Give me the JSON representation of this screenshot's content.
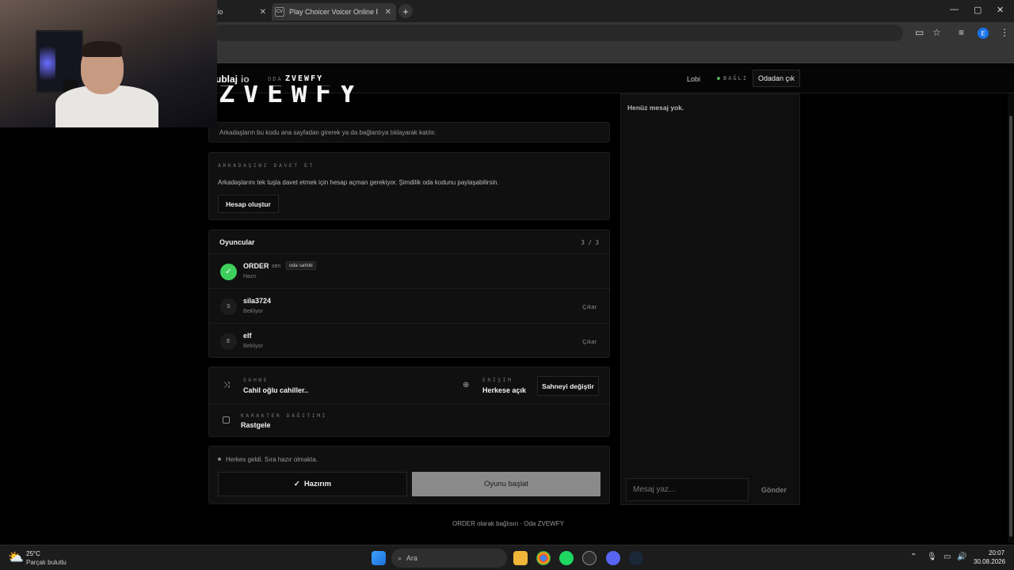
{
  "browser": {
    "tabs": [
      {
        "title": ".io",
        "active": false
      },
      {
        "title": "Play Choicer Voicer Online Free",
        "favicon": "CV",
        "active": true
      }
    ],
    "window_controls": [
      "—",
      "▢",
      "✕"
    ]
  },
  "webcam": {
    "description_icon": "webcam-overlay"
  },
  "header": {
    "logo_main": "ublaj",
    "logo_suffix": "io",
    "room_label": "ODA",
    "room_code": "ZVEWFY",
    "nav_lobby": "Lobi",
    "status": "BAĞLI",
    "leave_label": "Odadan çık"
  },
  "room": {
    "big_code": "ZVEWFY",
    "join_hint": "Arkadaşların bu kodu ana sayfadan girerek ya da bağlantıya tıklayarak katılır."
  },
  "invite": {
    "heading": "ARKADAŞINI DAVET ET",
    "text": "Arkadaşlarını tek tuşla davet etmek için hesap açman gerekiyor. Şimdilik oda kodunu paylaşabilirsin.",
    "button": "Hesap oluştur"
  },
  "players": {
    "title": "Oyuncular",
    "count": "3 / 3",
    "list": [
      {
        "initial": "✓",
        "name": "ORDER",
        "you": "sen",
        "badge": "oda sahibi",
        "status": "Hazır",
        "kick": ""
      },
      {
        "initial": "S",
        "name": "sila3724",
        "status": "Bekliyor",
        "kick": "Çıkar"
      },
      {
        "initial": "E",
        "name": "elf",
        "status": "Bekliyor",
        "kick": "Çıkar"
      }
    ]
  },
  "settings": {
    "scene_label": "SAHNE",
    "scene_value": "Cahil oğlu cahiller..",
    "access_label": "ERİŞİM",
    "access_value": "Herkese açık",
    "change_scene": "Sahneyi değiştir",
    "cast_label": "KARAKTER DAĞITIMI",
    "cast_value": "Rastgele"
  },
  "ready": {
    "message": "Herkes geldi. Sıra hazır olmakta.",
    "ready_button": "Hazırım",
    "start_button": "Oyunu başlat"
  },
  "footer": {
    "text": "ORDER olarak bağlısın · Oda ZVEWFY"
  },
  "chat": {
    "empty": "Henüz mesaj yok.",
    "placeholder": "Mesaj yaz...",
    "send": "Gönder"
  },
  "taskbar": {
    "weather_temp": "25°C",
    "weather_desc": "Parçalı bulutlu",
    "search": "Ara",
    "time": "20:07",
    "date": "30.08.2026"
  },
  "colors": {
    "ready_green": "#3ecf5c",
    "start_button": "#8a8a8a",
    "status_dot": "#4caf50"
  }
}
